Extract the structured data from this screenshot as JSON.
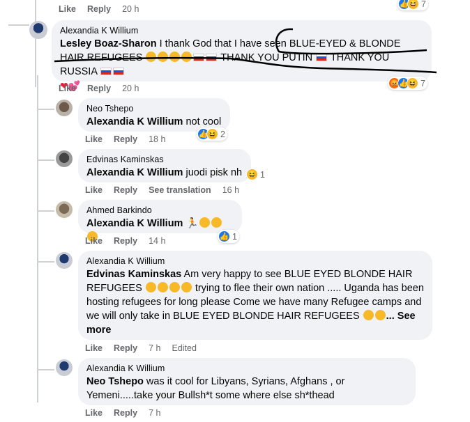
{
  "actions": {
    "like": "Like",
    "reply": "Reply",
    "see_translation": "See translation",
    "edited": "Edited"
  },
  "top_meta": {
    "time": "20 h",
    "react_count": "7"
  },
  "main_comment": {
    "author": "Alexandia K Willium",
    "mention": "Lesley Boaz-Sharon",
    "text1": " I thank God that I have seen BLUE-EYED & BLONDE HAIR REFUGEES ",
    "text2": " THANK YOU PUTIN ",
    "text3": " THANK YOU RUSSIA ",
    "time": "20 h",
    "react_count": "7"
  },
  "replies": [
    {
      "author": "Neo Tshepo",
      "mention": "Alexandia K Willium",
      "text": " not cool",
      "time": "18 h",
      "react_count": "2"
    },
    {
      "author": "Edvinas Kaminskas",
      "mention": "Alexandia K Willium",
      "text": " juodi pisk nh",
      "time": "16 h",
      "react_count": "1"
    },
    {
      "author": "Ahmed Barkindo",
      "mention": "Alexandia K Willium",
      "text": " ",
      "time": "14 h",
      "react_count": "1"
    },
    {
      "author": "Alexandia K Willium",
      "mention": "Edvinas Kaminskas",
      "text": " Am very happy to see BLUE EYED BLONDE HAIR REFUGEES ",
      "text_b": " trying to flee their own nation ..... Uganda has been hosting refugees for long please Come we have many Refugee camps and we will only take in BLUE EYED BLONDE HAIR REFUGEES ",
      "see_more": "... See more",
      "time": "7 h"
    },
    {
      "author": "Alexandia K Willium",
      "mention": "Neo Tshepo",
      "text": " was it cool for Libyans, Syrians, Afghans , or Yemeni.....take your Bullsh*t some where else sh*thead",
      "time": "7 h"
    }
  ],
  "colors": {
    "bubble": "#f0f2f5",
    "like_blue": "#1877f2",
    "haha_yellow": "#f7b928",
    "meta_gray": "#65676b"
  }
}
